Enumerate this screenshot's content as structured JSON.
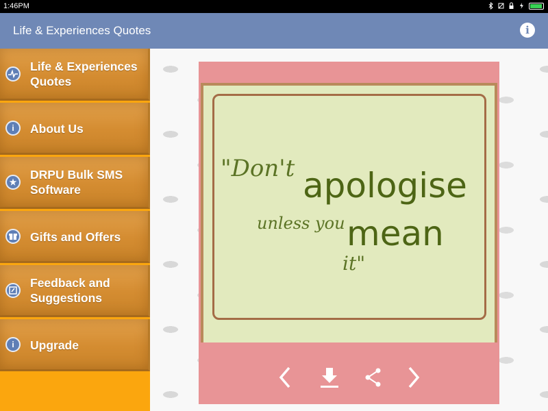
{
  "status_bar": {
    "time": "1:46PM"
  },
  "app_bar": {
    "title": "Life & Experiences Quotes",
    "info_icon": "info-icon"
  },
  "sidebar": {
    "items": [
      {
        "label": "Life & Experiences Quotes",
        "icon": "heartbeat-icon"
      },
      {
        "label": "About Us",
        "icon": "info-icon"
      },
      {
        "label": "DRPU Bulk SMS Software",
        "icon": "star-icon"
      },
      {
        "label": "Gifts and Offers",
        "icon": "gift-icon"
      },
      {
        "label": "Feedback and Suggestions",
        "icon": "feedback-icon"
      },
      {
        "label": "Upgrade",
        "icon": "info-icon"
      }
    ]
  },
  "quote": {
    "line1a": "\"Don't",
    "line1b": "apologise",
    "line2a": "unless you",
    "line2b": "mean",
    "line3": "it\""
  },
  "controls": {
    "prev": "chevron-left-icon",
    "download": "download-icon",
    "share": "share-icon",
    "next": "chevron-right-icon"
  },
  "colors": {
    "app_bar": "#6f88b6",
    "sidebar_bg": "#fba60e",
    "card_pink": "#e89496",
    "card_green": "#e2eabe",
    "quote_text": "#4d6515"
  }
}
